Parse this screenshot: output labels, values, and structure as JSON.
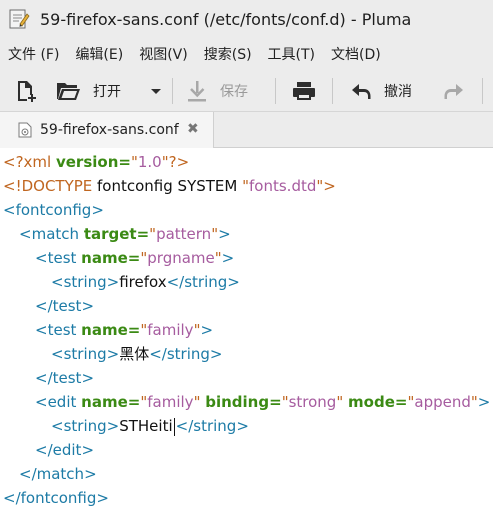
{
  "window": {
    "title": "59-firefox-sans.conf (/etc/fonts/conf.d) - Pluma",
    "app_icon": "text-editor-icon"
  },
  "menu": {
    "items": [
      "文件 (F)",
      "编辑(E)",
      "视图(V)",
      "搜索(S)",
      "工具(T)",
      "文档(D)"
    ]
  },
  "toolbar": {
    "new_icon": "new-document-icon",
    "open_icon": "open-folder-icon",
    "open_label": "打开",
    "open_dropdown_icon": "chevron-down-icon",
    "save_icon": "save-download-icon",
    "save_label": "保存",
    "print_icon": "printer-icon",
    "undo_icon": "undo-icon",
    "undo_label": "撤消",
    "redo_icon": "redo-icon"
  },
  "tabs": [
    {
      "label": "59-firefox-sans.conf",
      "close": "✖",
      "icon": "document-icon"
    }
  ],
  "editor": {
    "lines": [
      {
        "indent": 0,
        "parts": [
          [
            "decl",
            "<?xml "
          ],
          [
            "attr",
            "version"
          ],
          [
            "eq",
            "="
          ],
          [
            "q",
            "\""
          ],
          [
            "val",
            "1.0"
          ],
          [
            "q",
            "\""
          ],
          [
            "decl",
            "?>"
          ]
        ]
      },
      {
        "indent": 0,
        "parts": [
          [
            "dt",
            "<!DOCTYPE "
          ],
          [
            "txt",
            "fontconfig SYSTEM "
          ],
          [
            "q",
            "\""
          ],
          [
            "val",
            "fonts.dtd"
          ],
          [
            "q",
            "\""
          ],
          [
            "dt",
            ">"
          ]
        ]
      },
      {
        "indent": 0,
        "parts": [
          [
            "br",
            "<"
          ],
          [
            "tag",
            "fontconfig"
          ],
          [
            "br",
            ">"
          ]
        ]
      },
      {
        "indent": 1,
        "parts": [
          [
            "br",
            "<"
          ],
          [
            "tag",
            "match"
          ],
          [
            "txt",
            " "
          ],
          [
            "attr",
            "target"
          ],
          [
            "eq",
            "="
          ],
          [
            "q",
            "\""
          ],
          [
            "val",
            "pattern"
          ],
          [
            "q",
            "\""
          ],
          [
            "br",
            ">"
          ]
        ]
      },
      {
        "indent": 2,
        "parts": [
          [
            "br",
            "<"
          ],
          [
            "tag",
            "test"
          ],
          [
            "txt",
            " "
          ],
          [
            "attr",
            "name"
          ],
          [
            "eq",
            "="
          ],
          [
            "q",
            "\""
          ],
          [
            "val",
            "prgname"
          ],
          [
            "q",
            "\""
          ],
          [
            "br",
            ">"
          ]
        ]
      },
      {
        "indent": 3,
        "parts": [
          [
            "br",
            "<"
          ],
          [
            "tag",
            "string"
          ],
          [
            "br",
            ">"
          ],
          [
            "txt",
            "firefox"
          ],
          [
            "br",
            "</"
          ],
          [
            "tag",
            "string"
          ],
          [
            "br",
            ">"
          ]
        ]
      },
      {
        "indent": 2,
        "parts": [
          [
            "br",
            "</"
          ],
          [
            "tag",
            "test"
          ],
          [
            "br",
            ">"
          ]
        ]
      },
      {
        "indent": 2,
        "parts": [
          [
            "br",
            "<"
          ],
          [
            "tag",
            "test"
          ],
          [
            "txt",
            " "
          ],
          [
            "attr",
            "name"
          ],
          [
            "eq",
            "="
          ],
          [
            "q",
            "\""
          ],
          [
            "val",
            "family"
          ],
          [
            "q",
            "\""
          ],
          [
            "br",
            ">"
          ]
        ]
      },
      {
        "indent": 3,
        "parts": [
          [
            "br",
            "<"
          ],
          [
            "tag",
            "string"
          ],
          [
            "br",
            ">"
          ],
          [
            "txt",
            "黑体"
          ],
          [
            "br",
            "</"
          ],
          [
            "tag",
            "string"
          ],
          [
            "br",
            ">"
          ]
        ]
      },
      {
        "indent": 2,
        "parts": [
          [
            "br",
            "</"
          ],
          [
            "tag",
            "test"
          ],
          [
            "br",
            ">"
          ]
        ]
      },
      {
        "indent": 2,
        "parts": [
          [
            "br",
            "<"
          ],
          [
            "tag",
            "edit"
          ],
          [
            "txt",
            " "
          ],
          [
            "attr",
            "name"
          ],
          [
            "eq",
            "="
          ],
          [
            "q",
            "\""
          ],
          [
            "val",
            "family"
          ],
          [
            "q",
            "\""
          ],
          [
            "txt",
            " "
          ],
          [
            "attr",
            "binding"
          ],
          [
            "eq",
            "="
          ],
          [
            "q",
            "\""
          ],
          [
            "val",
            "strong"
          ],
          [
            "q",
            "\""
          ],
          [
            "txt",
            " "
          ],
          [
            "attr",
            "mode"
          ],
          [
            "eq",
            "="
          ],
          [
            "q",
            "\""
          ],
          [
            "val",
            "append"
          ],
          [
            "q",
            "\""
          ],
          [
            "br",
            ">"
          ]
        ]
      },
      {
        "indent": 3,
        "parts": [
          [
            "br",
            "<"
          ],
          [
            "tag",
            "string"
          ],
          [
            "br",
            ">"
          ],
          [
            "txt",
            "STHeiti"
          ],
          [
            "caret",
            ""
          ],
          [
            "br",
            "</"
          ],
          [
            "tag",
            "string"
          ],
          [
            "br",
            ">"
          ]
        ]
      },
      {
        "indent": 2,
        "parts": [
          [
            "br",
            "</"
          ],
          [
            "tag",
            "edit"
          ],
          [
            "br",
            ">"
          ]
        ]
      },
      {
        "indent": 1,
        "parts": [
          [
            "br",
            "</"
          ],
          [
            "tag",
            "match"
          ],
          [
            "br",
            ">"
          ]
        ]
      },
      {
        "indent": 0,
        "parts": [
          [
            "br",
            "</"
          ],
          [
            "tag",
            "fontconfig"
          ],
          [
            "br",
            ">"
          ]
        ]
      }
    ]
  }
}
